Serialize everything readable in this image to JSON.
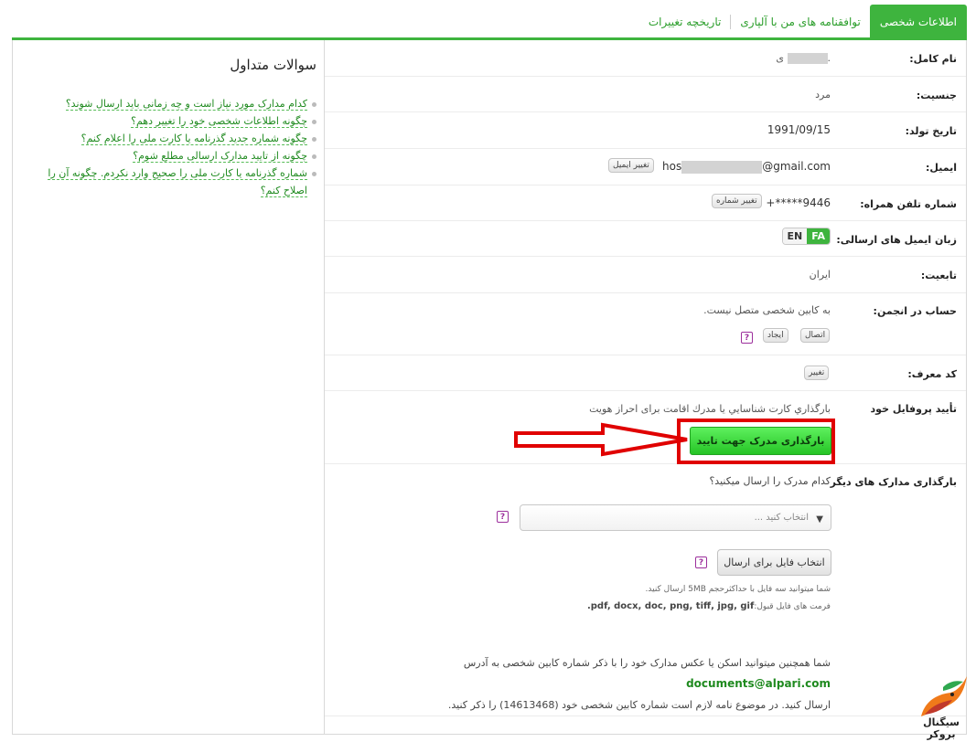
{
  "tabs": [
    {
      "label": "اطلاعات شخصی",
      "active": true
    },
    {
      "label": "توافقنامه های من با آلپاری",
      "active": false
    },
    {
      "label": "تاریخچه تغییرات",
      "active": false
    }
  ],
  "faq": {
    "title": "سوالات متداول",
    "items": [
      "کدام مدارک مورد نیاز است و چه زمانی باید ارسال شوند؟",
      "چگونه اطلاعات شخصی خود را تغییر دهم؟",
      "چگونه شماره جدید گذرنامه یا کارت ملی را اعلام کنم؟",
      "چگونه از تایید مدارک ارسالی مطلع شوم؟",
      "شماره گذرنامه یا کارت ملی را صحیح وارد نکردم. چگونه آن را اصلاح کنم؟"
    ]
  },
  "profile": {
    "fullname": {
      "label": "نام کامل:",
      "value": "ی",
      "value_prefix": "."
    },
    "gender": {
      "label": "جنسیت:",
      "value": "مرد"
    },
    "birthdate": {
      "label": "تاریخ تولد:",
      "value": "1991/09/15"
    },
    "email": {
      "label": "ایمیل:",
      "value_start": "hos",
      "value_end": "@gmail.com",
      "button": "تغییر ایمیل"
    },
    "phone": {
      "label": "شماره تلفن همراه:",
      "value": "+*****9446",
      "button": "تغییر شماره"
    },
    "email_lang": {
      "label": "زبان ایمیل های ارسالی:",
      "fa": "FA",
      "en": "EN"
    },
    "citizenship": {
      "label": "تابعیت:",
      "value": "ایران"
    },
    "forum": {
      "label": "حساب در انجمن:",
      "value": "به کابین شخصی متصل نیست.",
      "connect": "اتصال",
      "create": "ایجاد",
      "help": "?"
    },
    "referral": {
      "label": "کد معرف:",
      "button": "تغییر"
    },
    "verify": {
      "label": "تأیید پروفایل خود",
      "text": "بارگذاري كارت شناسايي يا مدرك اقامت براى احراز هويت",
      "button": "بارگذاری مدرک جهت تایید"
    },
    "other_docs": {
      "label": "بارگذاری مدارک های دیگر",
      "question": "کدام مدرک را ارسال میکنید؟",
      "select_placeholder": "انتخاب کنید ...",
      "file_button": "انتخاب فایل برای ارسال",
      "help": "?",
      "hint_size": "شما میتوانید سه فایل با حداکثرحجم 5MB ارسال کنید.",
      "hint_formats_label": "فرمت های فایل قبول:",
      "hint_formats": "pdf, docx, doc, png, tiff, jpg, gif.",
      "note_line1": "شما همچنین میتوانید اسکن یا عکس مدارک خود را با ذکر شماره کابین شخصی به آدرس",
      "note_email": "documents@alpari.com",
      "note_line2": "ارسال کنید. در موضوع نامه لازم است شماره کابین شخصی خود (14613468) را ذکر کنید."
    }
  },
  "watermark": {
    "text": "سیگنال بروکر"
  },
  "colors": {
    "accent": "#3eb43e",
    "link": "#1f8a1f",
    "highlight": "#e00000",
    "help": "#9c2f9c"
  }
}
